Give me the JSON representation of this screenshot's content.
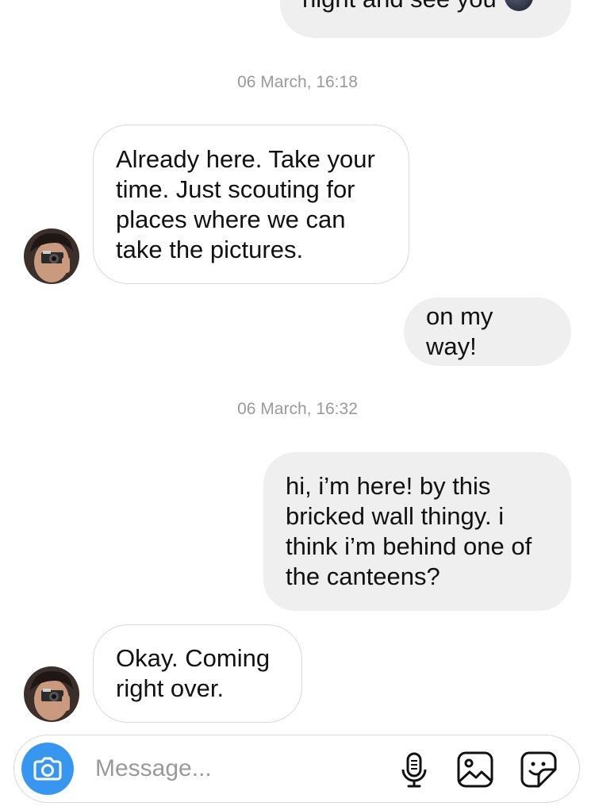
{
  "conversation": {
    "partial_message": {
      "text": "night and see you",
      "emoji": "new-moon-face"
    },
    "timestamps": [
      "06 March, 16:18",
      "06 March, 16:32"
    ],
    "messages": [
      {
        "direction": "incoming",
        "text": "Already here. Take your\ntime. Just scouting for\nplaces where we can\ntake the pictures."
      },
      {
        "direction": "outgoing",
        "text": "on my way!"
      },
      {
        "direction": "outgoing",
        "text": "hi, i’m here! by this\nbricked wall thingy. i\nthink i’m behind one of\nthe canteens?"
      },
      {
        "direction": "incoming",
        "text": "Okay. Coming\nright over."
      }
    ]
  },
  "composer": {
    "placeholder": "Message...",
    "icons": [
      "camera-icon",
      "microphone-icon",
      "gallery-icon",
      "sticker-icon"
    ]
  },
  "colors": {
    "outgoing_bubble": "#efefef",
    "incoming_border": "#d9d9d9",
    "timestamp_text": "#9a9a9a",
    "camera_button": "#3797f0"
  }
}
